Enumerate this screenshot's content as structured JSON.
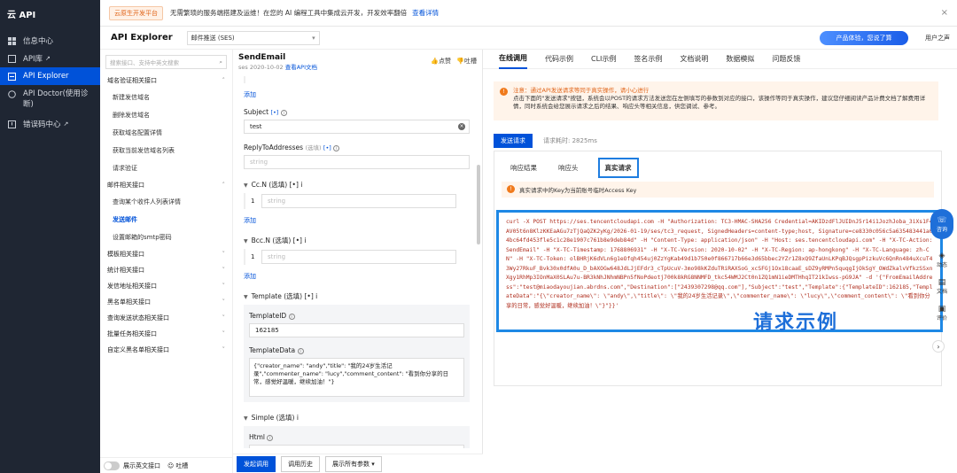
{
  "nav": {
    "brand": "云 API",
    "items": [
      {
        "label": "信息中心"
      },
      {
        "label": "API库"
      },
      {
        "label": "API Explorer"
      },
      {
        "label": "API Doctor(使用诊断)"
      },
      {
        "label": "错误码中心"
      }
    ]
  },
  "topbar": {
    "badge": "云原生开发平台",
    "notice": "无需繁琐的服务端搭建及运维！在您的 AI 编程工具中集成云开发，开发效率翻倍",
    "link": "查看详情",
    "close": "×"
  },
  "header": {
    "title": "API Explorer",
    "service_select": "邮件推送 (SES)",
    "promo": "产品体验，您说了算",
    "user": "用户之声"
  },
  "sidebar": {
    "search_placeholder": "搜索接口、支持中英文搜索",
    "groups": [
      {
        "label": "域名验证相关接口",
        "sub": [
          "新建发信域名",
          "删除发信域名",
          "获取域名配置详情",
          "获取当前发信域名列表",
          "请求验证"
        ]
      },
      {
        "label": "邮件相关接口",
        "sub": [
          "查询某个收件人列表详情",
          "发送邮件",
          "设置邮箱的smtp密码"
        ]
      },
      {
        "label": "模板相关接口",
        "sub": []
      },
      {
        "label": "统计相关接口",
        "sub": []
      },
      {
        "label": "发信地址相关接口",
        "sub": []
      },
      {
        "label": "黑名单相关接口",
        "sub": []
      },
      {
        "label": "查询发送状态相关接口",
        "sub": []
      },
      {
        "label": "批量任务相关接口",
        "sub": []
      },
      {
        "label": "自定义黑名单相关接口",
        "sub": []
      }
    ],
    "footer_toggle": "展示英文接口",
    "footer_feedback": "吐槽"
  },
  "api": {
    "name": "SendEmail",
    "sub": "ses 2020-10-02",
    "doc_link": "查看API文档",
    "like": "点赞",
    "dislike": "吐槽"
  },
  "form": {
    "add": "添加",
    "subject_label": "Subject",
    "subject_value": "test",
    "arr_tag": "[•]",
    "optional": "(选填)",
    "reply_label": "ReplyToAddresses",
    "placeholder_string": "string",
    "cc_label": "Cc.N",
    "bcc_label": "Bcc.N",
    "row_index": "1",
    "template_label": "Template",
    "template_id_label": "TemplateID",
    "template_id_value": "162185",
    "template_data_label": "TemplateData",
    "template_data_value": "{\"creator_name\": \"andy\",\"title\": \"我的24岁生活记录\",\"commenter_name\": \"lucy\",\"comment_content\": \"看到你分享的日常，感觉好温暖，继续加油！\"}",
    "simple_label": "Simple",
    "html_label": "Html",
    "btn_send": "发起调用",
    "btn_history": "调用历史",
    "btn_show_all": "展示所有参数"
  },
  "right": {
    "tabs": [
      "在线调用",
      "代码示例",
      "CLI示例",
      "签名示例",
      "文档说明",
      "数据模拟",
      "问题反馈"
    ],
    "warn_title": "注意：通过API发送请求等同于真实操作，请小心进行",
    "warn_body": "点击下面的\"发送请求\"按钮，系统会以POST的请求方法发送您在左侧填写的参数到对应的接口，该操作等同于真实操作，建议您仔细阅读产品计费文档了解费用详情，同时系统会给您展示请求之后的结果、响应头等相关信息，供您调试、参考。",
    "send_btn": "发送请求",
    "timing": "请求耗时: 2825ms",
    "result_tabs": [
      "响应结果",
      "响应头",
      "真实请求"
    ],
    "info": "真实请求中的Key为当前账号临时Access Key",
    "code": "curl -X POST https://ses.tencentcloudapi.com -H \"Authorization: TC3-HMAC-SHA256 Credential=AKIDzdFlJUIDnJ5r14i1JozhJoba_3iXs1F4AV05t6n8KlzKKEaAGu7zTjQaQZK2yKg/2026-01-19/ses/tc3_request, SignedHeaders=content-type;host, Signature=ce8330c056c5a635483441a04bc64fd453fle5c1c28e1907c761b8e9deb84d\" -H \"Content-Type: application/json\" -H \"Host: ses.tencentcloudapi.com\" -H \"X-TC-Action: SendEmail\" -H \"X-TC-Timestamp: 1768806931\" -H \"X-TC-Version: 2020-10-02\" -H \"X-TC-Region: ap-hongkong\" -H \"X-TC-Language: zh-CN\" -H \"X-TC-Token: olBHRjK6dVLn6g1eOfqh454uj0ZzYgKab49d1b750e0f866717b66e3d65bbec2YZr1Z8xQ9ZfaUnLKPqBJQsgpPizkuVc6QnRn484uXcuT43Wy27RkuF_Bvk30x0dfA0u_D_bAXOGw648JdLJjEFdr3_cTpUcuV-3mo98kKZduTRiRAXSoG_xcSFGj1Ox18caaE_sDZ9yRMPn5quqgIjOkSgY_OWdZkalvVfkzSSxnXgy1RhMp3IOnMaX0SLAu7u-BR3kNhJNhmNBPn5fNoPdeotj700k8kRG8NNMFD_tkc54WMJ2Ct0n1ZQ1mN1ieDMTHhqIT21kIwss-pG9JA\" -d '{\"FromEmailAddress\":\"test@miaodayoujian.abrdns.com\",\"Destination\":[\"2439307298@qq.com\"],\"Subject\":\"test\",\"Template\":{\"TemplateID\":162185,\"TemplateData\":\"{\\\"creator_name\\\": \\\"andy\\\",\\\"title\\\": \\\"我的24岁生活记录\\\",\\\"commenter_name\\\": \\\"lucy\\\",\\\"comment_content\\\": \\\"看到你分享的日常，感觉好温暖，继续加油！\\\"}\"}}'",
    "caption": "请求示例"
  },
  "sidetools": {
    "consult": "咨询",
    "items": [
      "动态",
      "文档",
      "评价"
    ]
  },
  "colors": {
    "accent": "#0052d9",
    "nav_bg": "#1f2633",
    "warn": "#f07a1c",
    "code_text": "#b03020",
    "highlight": "#1e88e5"
  }
}
